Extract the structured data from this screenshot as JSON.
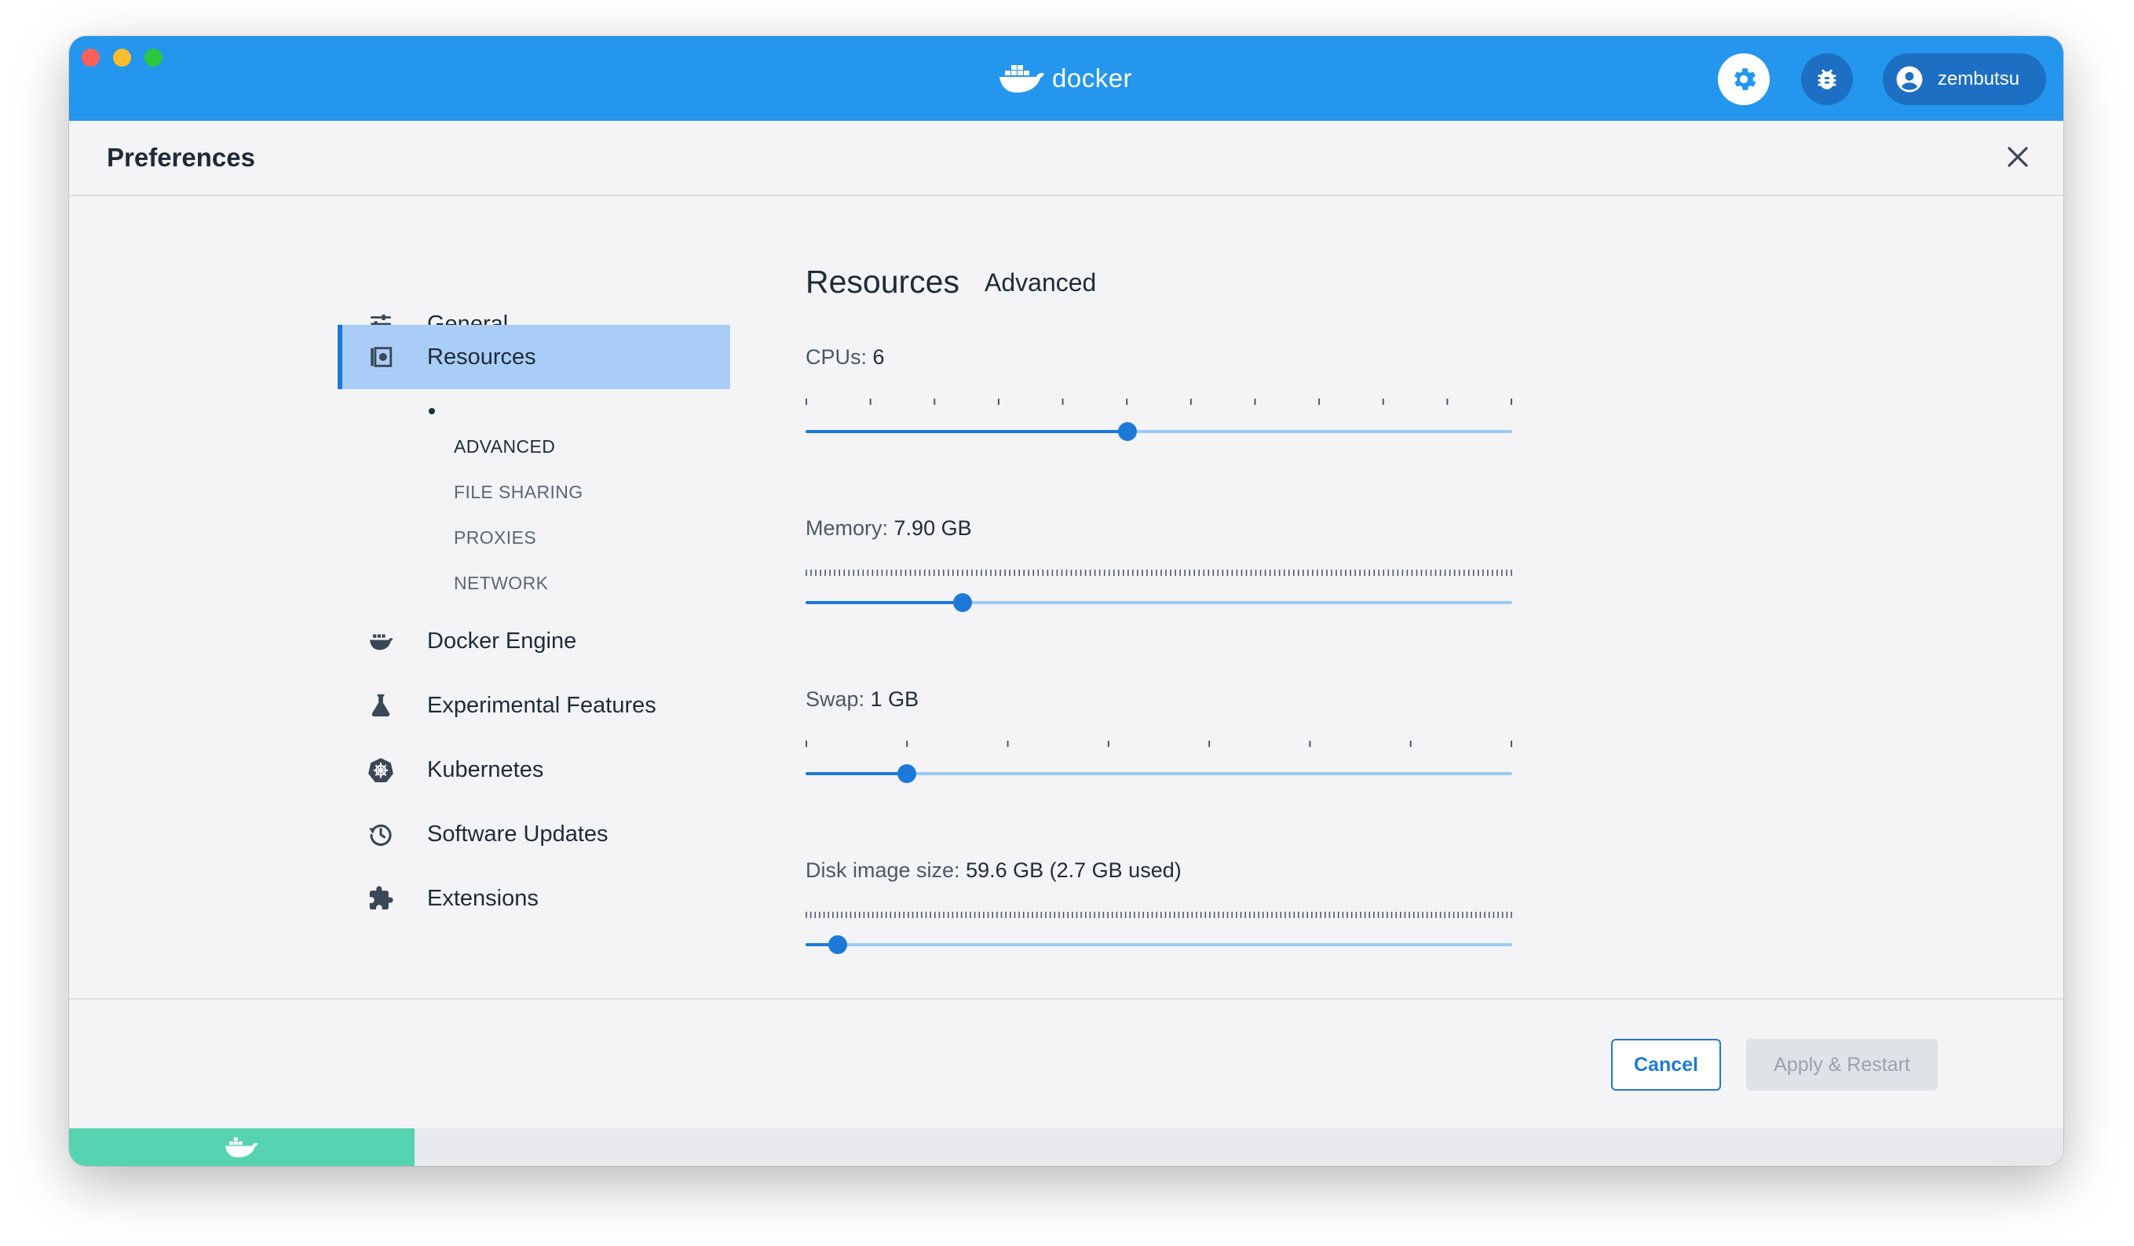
{
  "app": {
    "brand": "docker",
    "user": "zembutsu"
  },
  "header": {
    "title": "Preferences"
  },
  "sidebar": {
    "items": [
      {
        "label": "General",
        "icon": "sliders-icon"
      },
      {
        "label": "Resources",
        "icon": "resources-icon",
        "active": true
      },
      {
        "label": "Docker Engine",
        "icon": "whale-icon"
      },
      {
        "label": "Experimental Features",
        "icon": "flask-icon"
      },
      {
        "label": "Kubernetes",
        "icon": "kubernetes-icon"
      },
      {
        "label": "Software Updates",
        "icon": "history-icon"
      },
      {
        "label": "Extensions",
        "icon": "puzzle-icon"
      }
    ],
    "subitems": [
      "ADVANCED",
      "FILE SHARING",
      "PROXIES",
      "NETWORK"
    ]
  },
  "main": {
    "title": "Resources",
    "subtitle": "Advanced",
    "sliders": [
      {
        "label": "CPUs:",
        "value": "6",
        "fraction": 0.455,
        "ticks": 12
      },
      {
        "label": "Memory:",
        "value": "7.90 GB",
        "fraction": 0.222,
        "ticks": 150
      },
      {
        "label": "Swap:",
        "value": "1 GB",
        "fraction": 0.143,
        "ticks": 8
      },
      {
        "label": "Disk image size:",
        "value": "59.6 GB (2.7 GB used)",
        "fraction": 0.046,
        "ticks": 160
      }
    ]
  },
  "footer": {
    "cancel": "Cancel",
    "apply": "Apply & Restart"
  },
  "colors": {
    "brand": "#2496ed",
    "accent": "#1d79d9",
    "status": "#56d3b0",
    "active_bg": "#a9cdf6"
  }
}
